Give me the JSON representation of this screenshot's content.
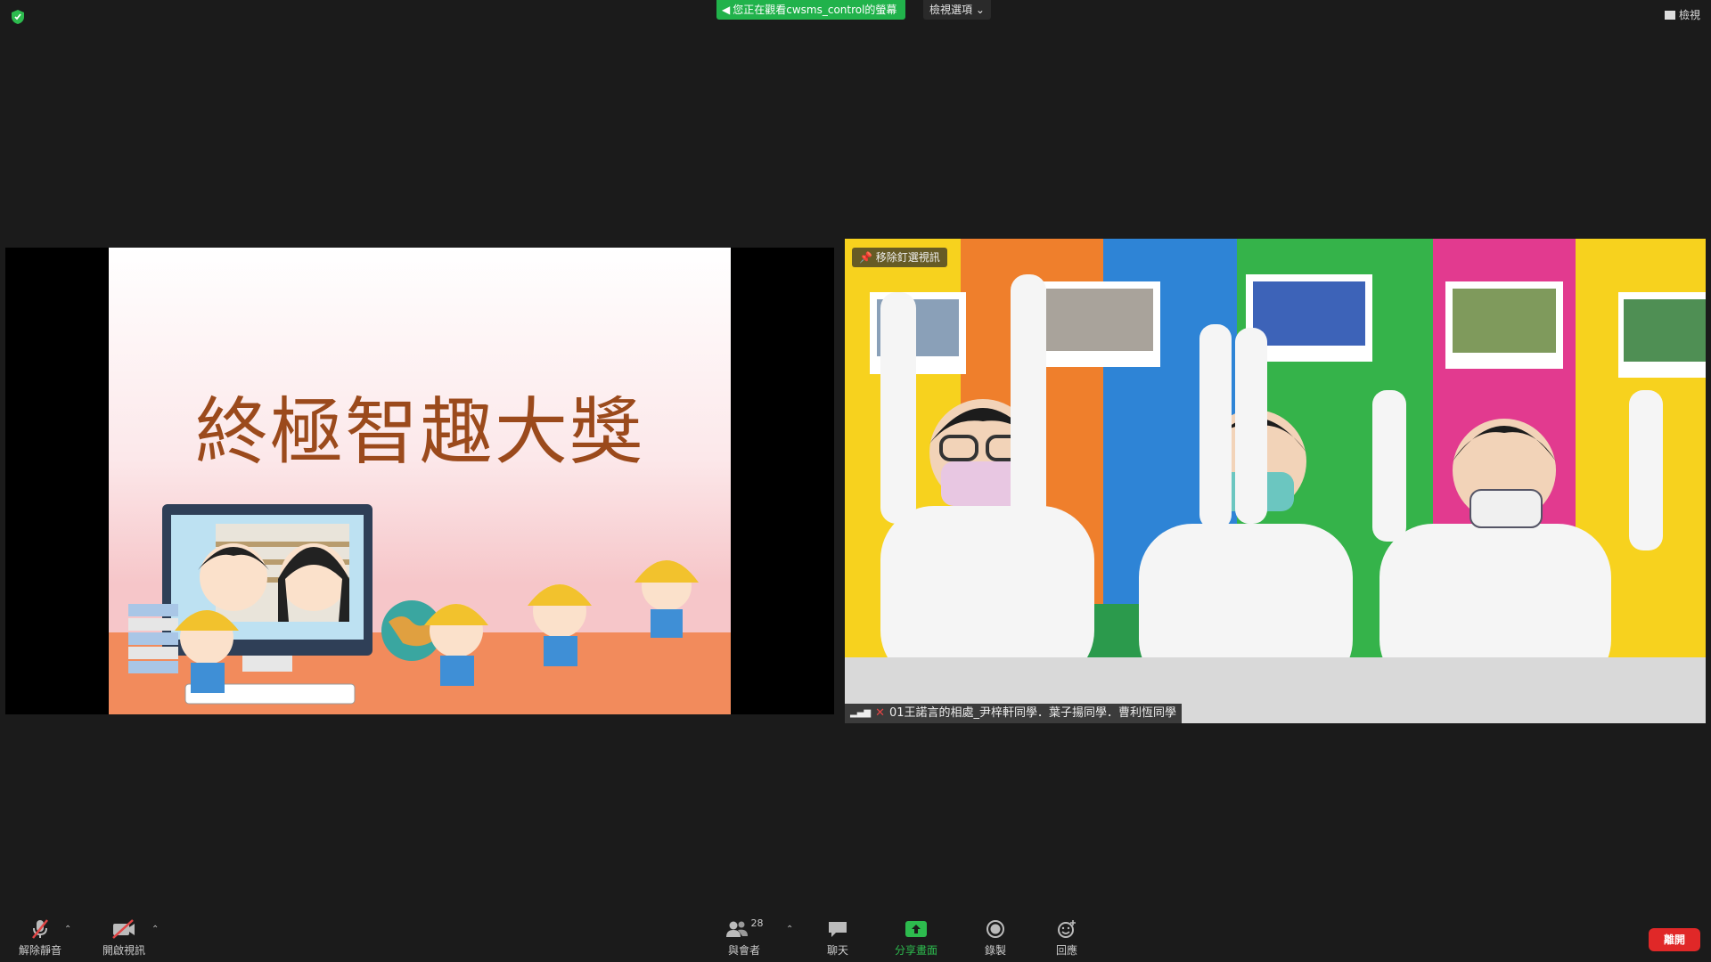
{
  "top_bar": {
    "share_banner": "您正在觀看cwsms_control的螢幕",
    "view_options": "檢視選項",
    "view_button": "檢視"
  },
  "slide": {
    "title": "終極智趣大獎"
  },
  "camera": {
    "pin_label": "移除釘選視訊",
    "participant_name": "01王諾言的相處_尹梓軒同學．葉子揚同學．曹利恆同學"
  },
  "toolbar": {
    "unmute": "解除靜音",
    "start_video": "開啟視訊",
    "participants": "與會者",
    "participant_count": "28",
    "chat": "聊天",
    "share_screen": "分享畫面",
    "record": "錄製",
    "reactions": "回應",
    "end": "離開"
  },
  "colors": {
    "background": "#1b1b1b",
    "share_green": "#21b24b",
    "end_red": "#e02828",
    "slide_title": "#9b4a1c"
  }
}
